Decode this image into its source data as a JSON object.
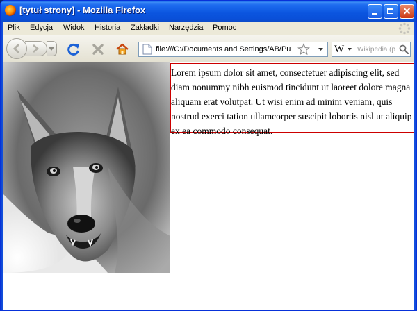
{
  "window": {
    "title": "[tytuł strony] - Mozilla Firefox",
    "buttons": {
      "minimize": "minimize",
      "maximize": "maximize",
      "close": "✕"
    }
  },
  "menu": [
    {
      "id": "plik",
      "label": "Plik"
    },
    {
      "id": "edycja",
      "label": "Edycja"
    },
    {
      "id": "widok",
      "label": "Widok"
    },
    {
      "id": "historia",
      "label": "Historia"
    },
    {
      "id": "zakladki",
      "label": "Zakładki"
    },
    {
      "id": "narzedzia",
      "label": "Narzędzia"
    },
    {
      "id": "pomoc",
      "label": "Pomoc"
    }
  ],
  "toolbar": {
    "icons": [
      "back-arrow-icon",
      "forward-arrow-icon",
      "history-dropdown-icon",
      "reload-icon",
      "stop-icon",
      "home-icon"
    ],
    "url": "file:///C:/Documents and Settings/AB/Pu",
    "search_placeholder": "Wikipedia (p",
    "search_engine": "W"
  },
  "content": {
    "image_alt": "wolf",
    "paragraph": "Lorem ipsum dolor sit amet, consectetuer adipiscing elit, sed diam nonummy nibh euismod tincidunt ut laoreet dolore magna aliquam erat volutpat. Ut wisi enim ad minim veniam, quis nostrud exerci tation ullamcorper suscipit lobortis nisl ut aliquip ex ea commodo consequat."
  },
  "colors": {
    "titlebar": "#0a55df",
    "chrome": "#ece9d8",
    "paragraph_border": "#cc0000",
    "reload_blue": "#1c62d6",
    "home_orange": "#f0a020"
  }
}
